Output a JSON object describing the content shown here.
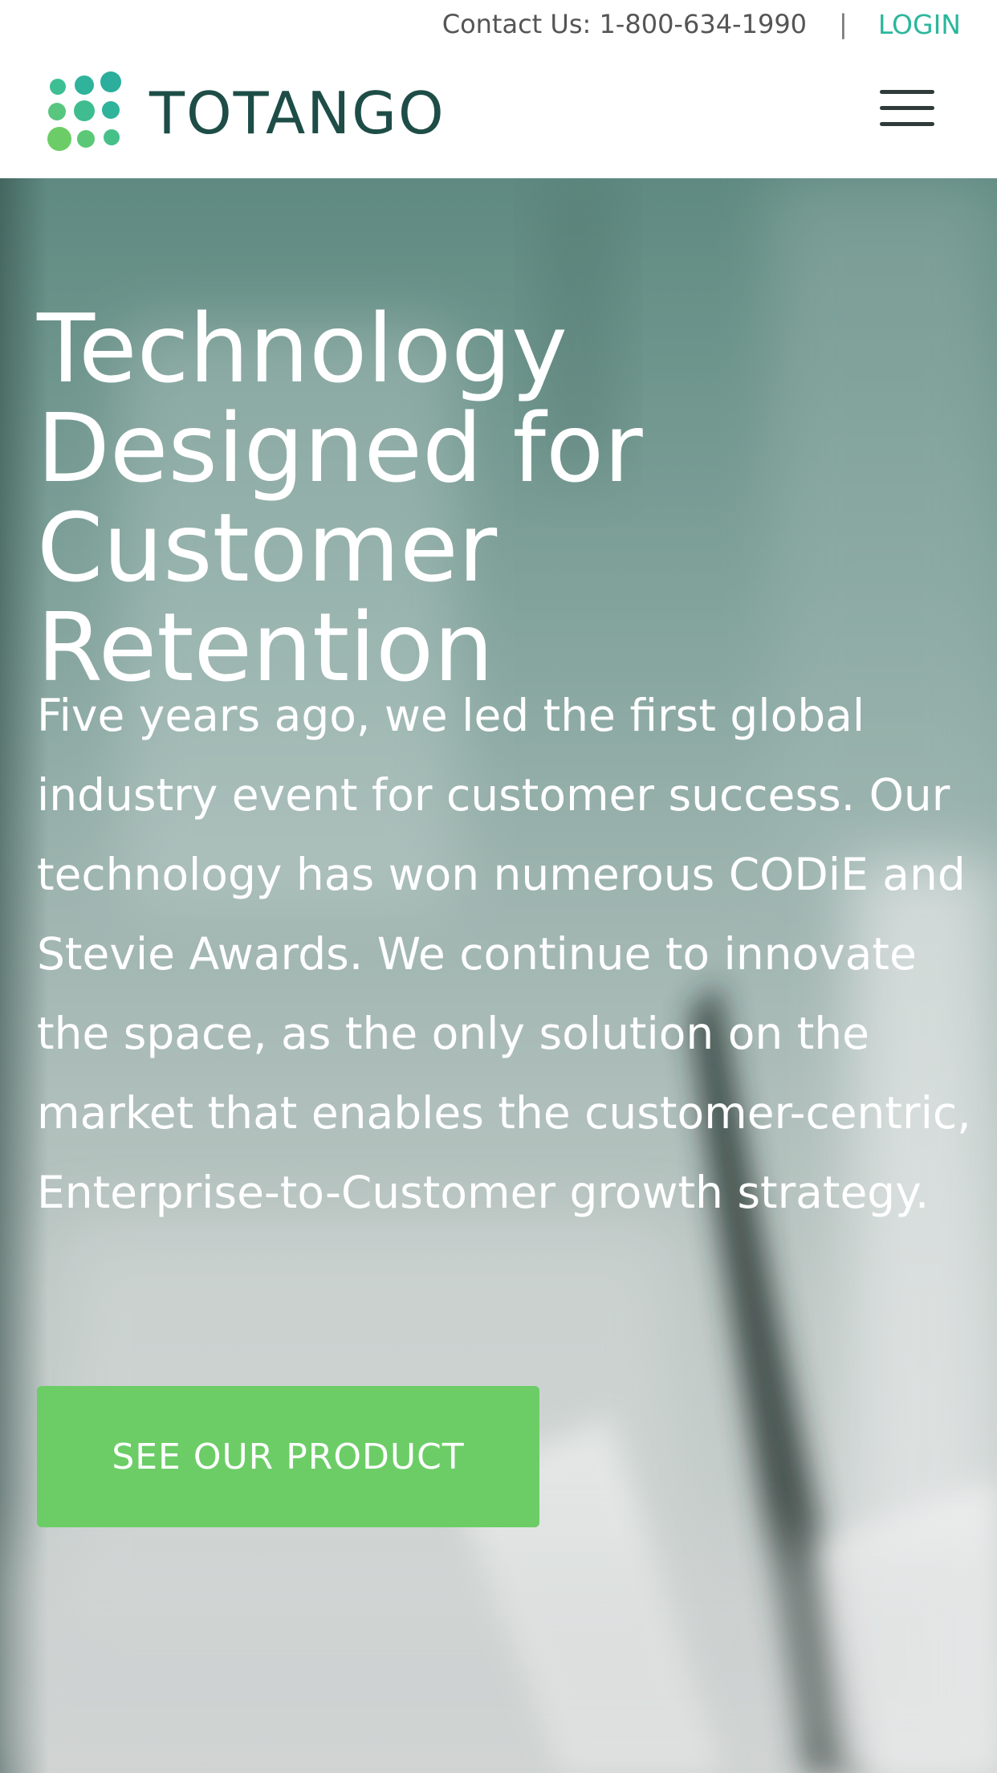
{
  "topbar": {
    "contact": "Contact Us: 1-800-634-1990",
    "separator": "|",
    "login": "LOGIN"
  },
  "logo": {
    "text": "TOTANGO",
    "icon": "dots-logo-icon"
  },
  "menu": {
    "icon": "hamburger-menu-icon"
  },
  "hero": {
    "title": "Technology Designed for Customer Retention",
    "description": "Five years ago, we led the first global industry event for customer success. Our technology has won numerous CODiE and Stevie Awards. We continue to innovate the space, as the only solution on the market that enables the customer-centric, Enterprise-to-Customer growth strategy.",
    "cta_label": "SEE OUR PRODUCT"
  },
  "colors": {
    "brand_dark": "#1e4d47",
    "brand_teal": "#2bb79c",
    "brand_green": "#6ccd67",
    "button": "#6ccd67"
  }
}
